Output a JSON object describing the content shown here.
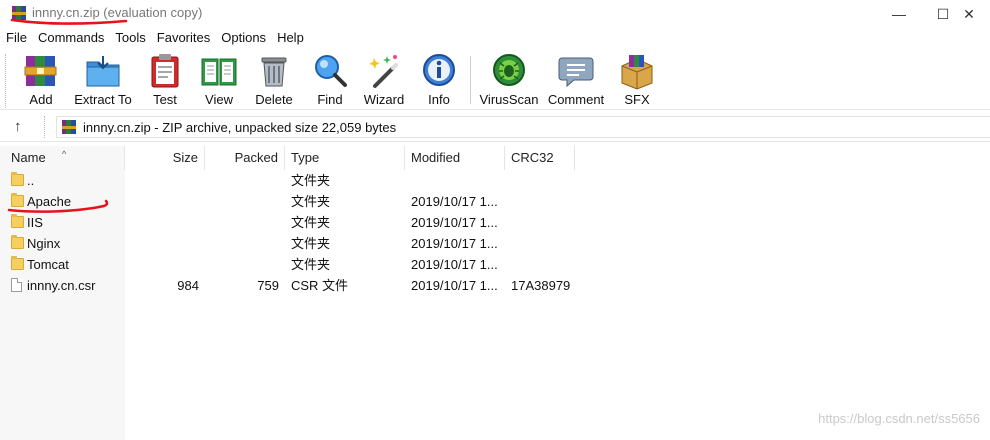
{
  "window": {
    "title": "innny.cn.zip (evaluation copy)",
    "minimize_glyph": "—",
    "maximize_glyph": "☐",
    "close_glyph": "✕"
  },
  "menu": [
    "File",
    "Commands",
    "Tools",
    "Favorites",
    "Options",
    "Help"
  ],
  "toolbar": [
    {
      "label": "Add",
      "icon": "add-archive-icon"
    },
    {
      "label": "Extract To",
      "icon": "extract-folder-icon"
    },
    {
      "label": "Test",
      "icon": "test-clipboard-icon"
    },
    {
      "label": "View",
      "icon": "view-book-icon"
    },
    {
      "label": "Delete",
      "icon": "trash-icon"
    },
    {
      "label": "Find",
      "icon": "magnifier-icon"
    },
    {
      "label": "Wizard",
      "icon": "wand-icon"
    },
    {
      "label": "Info",
      "icon": "info-icon"
    },
    {
      "label": "VirusScan",
      "icon": "virus-scan-icon"
    },
    {
      "label": "Comment",
      "icon": "comment-icon"
    },
    {
      "label": "SFX",
      "icon": "sfx-box-icon"
    }
  ],
  "address": {
    "up_glyph": "↑",
    "path": "innny.cn.zip - ZIP archive, unpacked size 22,059 bytes"
  },
  "columns": [
    "Name",
    "Size",
    "Packed",
    "Type",
    "Modified",
    "CRC32"
  ],
  "sort_glyph": "^",
  "rows": [
    {
      "name": "..",
      "size": "",
      "packed": "",
      "type": "文件夹",
      "modified": "",
      "crc": "",
      "kind": "folder"
    },
    {
      "name": "Apache",
      "size": "",
      "packed": "",
      "type": "文件夹",
      "modified": "2019/10/17 1...",
      "crc": "",
      "kind": "folder"
    },
    {
      "name": "IIS",
      "size": "",
      "packed": "",
      "type": "文件夹",
      "modified": "2019/10/17 1...",
      "crc": "",
      "kind": "folder"
    },
    {
      "name": "Nginx",
      "size": "",
      "packed": "",
      "type": "文件夹",
      "modified": "2019/10/17 1...",
      "crc": "",
      "kind": "folder"
    },
    {
      "name": "Tomcat",
      "size": "",
      "packed": "",
      "type": "文件夹",
      "modified": "2019/10/17 1...",
      "crc": "",
      "kind": "folder"
    },
    {
      "name": "innny.cn.csr",
      "size": "984",
      "packed": "759",
      "type": "CSR 文件",
      "modified": "2019/10/17 1...",
      "crc": "17A38979",
      "kind": "file"
    }
  ],
  "watermark": "https://blog.csdn.net/ss5656",
  "colors": {
    "annotation_red": "#e8131a",
    "folder_yellow": "#f5cf5f"
  }
}
